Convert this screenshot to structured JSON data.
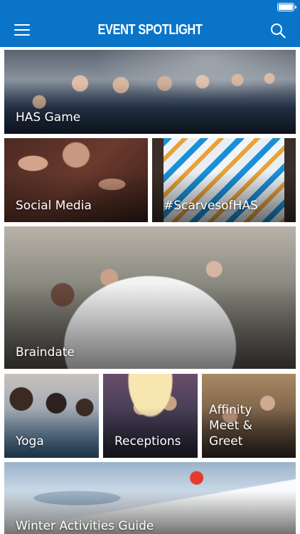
{
  "app": {
    "title": "EVENT SPOTLIGHT",
    "brand_color": "#0a74c9"
  },
  "status_bar": {
    "battery_icon": "battery-full-icon"
  },
  "app_bar": {
    "menu_icon": "hamburger-menu-icon",
    "search_icon": "search-icon"
  },
  "tiles": [
    {
      "label": "HAS Game"
    },
    {
      "label": "Social Media"
    },
    {
      "label": "#ScarvesofHAS"
    },
    {
      "label": "Braindate"
    },
    {
      "label": "Yoga"
    },
    {
      "label": "Receptions"
    },
    {
      "label": "Affinity\nMeet & Greet"
    },
    {
      "label": "Winter Activities Guide"
    }
  ]
}
